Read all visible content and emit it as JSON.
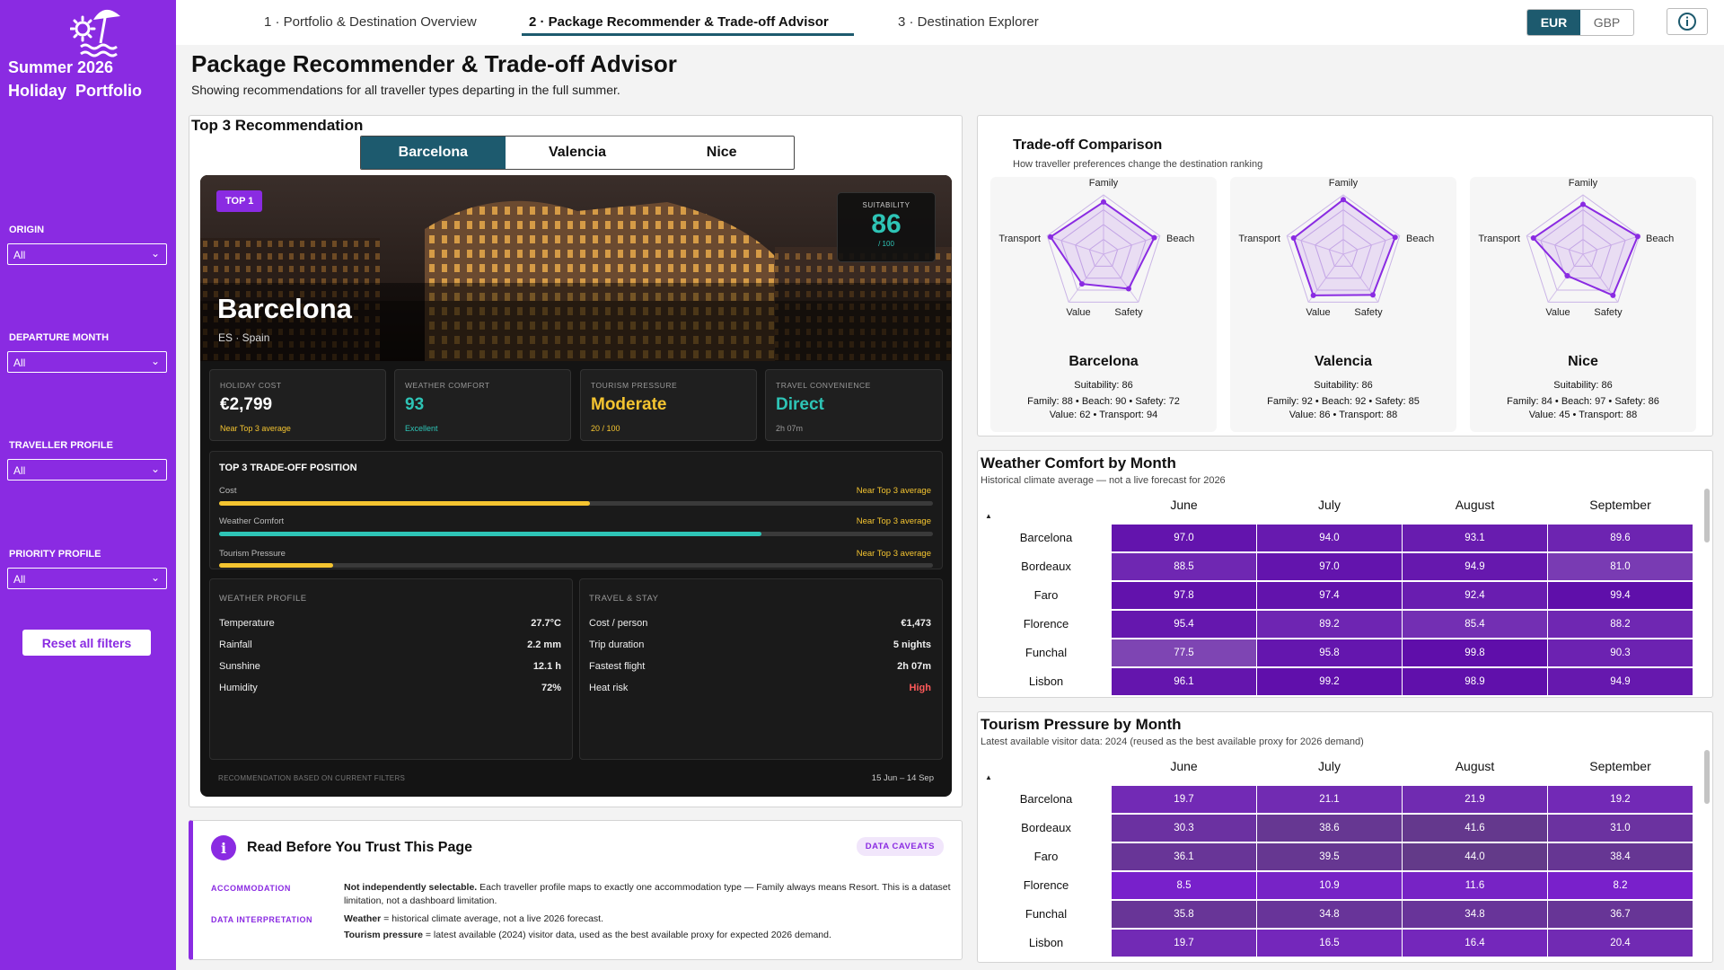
{
  "sidebar": {
    "brand": "Summer 2026\nHoliday  Portfolio",
    "filters": [
      {
        "label": "ORIGIN",
        "value": "All"
      },
      {
        "label": "DEPARTURE MONTH",
        "value": "All"
      },
      {
        "label": "TRAVELLER PROFILE",
        "value": "All"
      },
      {
        "label": "PRIORITY PROFILE",
        "value": "All"
      }
    ],
    "reset_label": "Reset all filters"
  },
  "tabs": [
    {
      "label": "1 · Portfolio & Destination Overview"
    },
    {
      "label": "2 · Package Recommender & Trade-off Advisor"
    },
    {
      "label": "3 · Destination Explorer"
    }
  ],
  "currency": {
    "options": [
      "EUR",
      "GBP"
    ],
    "selected": "EUR"
  },
  "page": {
    "title": "Package Recommender & Trade-off Advisor",
    "subtitle": "Showing recommendations for all traveller types departing in the full summer."
  },
  "top3": {
    "title": "Top 3 Recommendation",
    "options": [
      "Barcelona",
      "Valencia",
      "Nice"
    ],
    "selected": "Barcelona"
  },
  "card": {
    "badge": "TOP 1",
    "suitability_label": "SUITABILITY",
    "suitability_value": "86",
    "suitability_max": "/ 100",
    "destination": "Barcelona",
    "country": "ES · Spain",
    "kpis": [
      {
        "label": "HOLIDAY COST",
        "value": "€2,799",
        "sub": "Near Top 3 average",
        "color": "#ffffff",
        "sub_color": "#f4c430"
      },
      {
        "label": "WEATHER COMFORT",
        "value": "93",
        "sub": "Excellent",
        "color": "#2ec4b6",
        "sub_color": "#2ec4b6"
      },
      {
        "label": "TOURISM PRESSURE",
        "value": "Moderate",
        "sub": "20 / 100",
        "color": "#f4c430",
        "sub_color": "#f4c430"
      },
      {
        "label": "TRAVEL CONVENIENCE",
        "value": "Direct",
        "sub": "2h 07m",
        "color": "#2ec4b6",
        "sub_color": "#999999"
      }
    ],
    "tradeoff": {
      "title": "TOP 3 TRADE-OFF POSITION",
      "rows": [
        {
          "label": "Cost",
          "note": "Near Top 3 average",
          "fraction": 0.52,
          "color": "#f4c430"
        },
        {
          "label": "Weather Comfort",
          "note": "Near Top 3 average",
          "fraction": 0.76,
          "color": "#2ec4b6"
        },
        {
          "label": "Tourism Pressure",
          "note": "Near Top 3 average",
          "fraction": 0.16,
          "color": "#f4c430"
        }
      ]
    },
    "weather_profile": {
      "title": "WEATHER PROFILE",
      "rows": [
        {
          "k": "Temperature",
          "v": "27.7°C"
        },
        {
          "k": "Rainfall",
          "v": "2.2 mm"
        },
        {
          "k": "Sunshine",
          "v": "12.1 h"
        },
        {
          "k": "Humidity",
          "v": "72%"
        }
      ]
    },
    "travel_stay": {
      "title": "TRAVEL & STAY",
      "rows": [
        {
          "k": "Cost / person",
          "v": "€1,473"
        },
        {
          "k": "Trip duration",
          "v": "5 nights"
        },
        {
          "k": "Fastest flight",
          "v": "2h 07m"
        },
        {
          "k": "Heat risk",
          "v": "High",
          "alert": true
        }
      ]
    },
    "footer": "RECOMMENDATION BASED ON CURRENT FILTERS",
    "date_range": "15 Jun – 14 Sep"
  },
  "caveats": {
    "title": "Read Before You Trust This Page",
    "badge": "DATA CAVEATS",
    "items": [
      {
        "key": "ACCOMMODATION",
        "bold": "Not independently selectable.",
        "text": " Each traveller profile maps to exactly one accommodation type — Family always means Resort. This is a dataset limitation, not a dashboard limitation."
      },
      {
        "key": "DATA INTERPRETATION",
        "lines": [
          {
            "bold": "Weather",
            "text": " = historical climate average, not a live 2026 forecast."
          },
          {
            "bold": "Tourism pressure",
            "text": " = latest available (2024) visitor data, used as the best available proxy for expected 2026 demand."
          }
        ]
      }
    ]
  },
  "tradeoff_comparison": {
    "title": "Trade-off Comparison",
    "subtitle": "How traveller preferences change the destination ranking",
    "axes": [
      "Family",
      "Beach",
      "Safety",
      "Value",
      "Transport"
    ],
    "destinations": [
      {
        "name": "Barcelona",
        "suitability": "Suitability: 86",
        "line1": "Family: 88 • Beach: 90 • Safety: 72",
        "line2": "Value: 62 • Transport: 94",
        "scores": [
          88,
          90,
          72,
          62,
          94
        ]
      },
      {
        "name": "Valencia",
        "suitability": "Suitability: 86",
        "line1": "Family: 92 • Beach: 92 • Safety: 85",
        "line2": "Value: 86 • Transport: 88",
        "scores": [
          92,
          92,
          85,
          86,
          88
        ]
      },
      {
        "name": "Nice",
        "suitability": "Suitability: 86",
        "line1": "Family: 84 • Beach: 97 • Safety: 86",
        "line2": "Value: 45 • Transport: 88",
        "scores": [
          84,
          97,
          86,
          45,
          88
        ]
      }
    ]
  },
  "weather_matrix": {
    "title": "Weather Comfort by Month",
    "subtitle": "Historical climate average — not a live forecast for 2026",
    "months": [
      "June",
      "July",
      "August",
      "September"
    ],
    "rows": [
      {
        "name": "Barcelona",
        "values": [
          97.0,
          94.0,
          93.1,
          89.6
        ]
      },
      {
        "name": "Bordeaux",
        "values": [
          88.5,
          97.0,
          94.9,
          81.0
        ]
      },
      {
        "name": "Faro",
        "values": [
          97.8,
          97.4,
          92.4,
          99.4
        ]
      },
      {
        "name": "Florence",
        "values": [
          95.4,
          89.2,
          85.4,
          88.2
        ]
      },
      {
        "name": "Funchal",
        "values": [
          77.5,
          95.8,
          99.8,
          90.3
        ]
      },
      {
        "name": "Lisbon",
        "values": [
          96.1,
          99.2,
          98.9,
          94.9
        ]
      }
    ]
  },
  "tourism_matrix": {
    "title": "Tourism Pressure by Month",
    "subtitle": "Latest available visitor data: 2024 (reused as the best available proxy for 2026 demand)",
    "months": [
      "June",
      "July",
      "August",
      "September"
    ],
    "rows": [
      {
        "name": "Barcelona",
        "values": [
          19.7,
          21.1,
          21.9,
          19.2
        ]
      },
      {
        "name": "Bordeaux",
        "values": [
          30.3,
          38.6,
          41.6,
          31.0
        ]
      },
      {
        "name": "Faro",
        "values": [
          36.1,
          39.5,
          44.0,
          38.4
        ]
      },
      {
        "name": "Florence",
        "values": [
          8.5,
          10.9,
          11.6,
          8.2
        ]
      },
      {
        "name": "Funchal",
        "values": [
          35.8,
          34.8,
          34.8,
          36.7
        ]
      },
      {
        "name": "Lisbon",
        "values": [
          19.7,
          16.5,
          16.4,
          20.4
        ]
      }
    ]
  },
  "colors": {
    "accent": "#8a2be2",
    "teal": "#1d5a6e",
    "good": "#2ec4b6",
    "warn": "#f4c430",
    "alert": "#ff5a5a"
  }
}
